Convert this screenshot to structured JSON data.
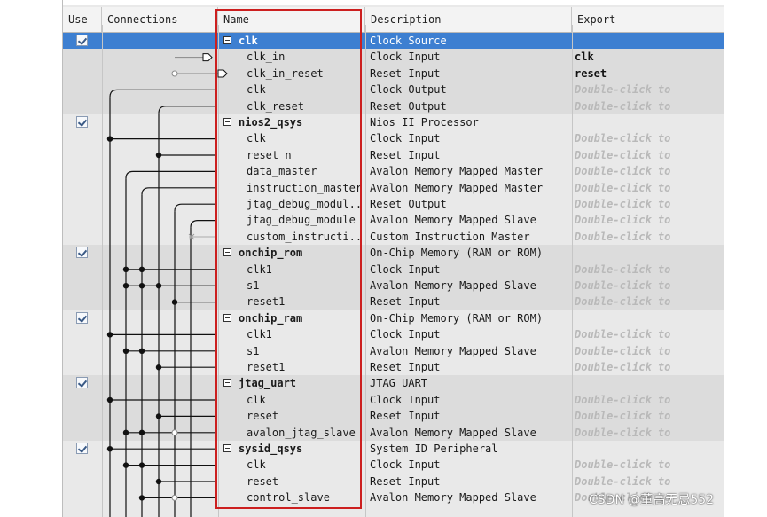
{
  "header": {
    "use": "Use",
    "connections": "Connections",
    "name": "Name",
    "description": "Description",
    "export": "Export"
  },
  "export_hint": "Double-click to",
  "rows": [
    {
      "kind": "module",
      "name": "clk",
      "desc": "Clock Source",
      "export": "",
      "checked": true,
      "selected": true
    },
    {
      "kind": "port",
      "name": "clk_in",
      "desc": "Clock Input",
      "export": "clk"
    },
    {
      "kind": "port",
      "name": "clk_in_reset",
      "desc": "Reset Input",
      "export": "reset"
    },
    {
      "kind": "port",
      "name": "clk",
      "desc": "Clock Output",
      "export": "hint"
    },
    {
      "kind": "port",
      "name": "clk_reset",
      "desc": "Reset Output",
      "export": "hint"
    },
    {
      "kind": "module",
      "name": "nios2_qsys",
      "desc": "Nios II Processor",
      "export": "",
      "checked": true
    },
    {
      "kind": "port",
      "name": "clk",
      "desc": "Clock Input",
      "export": "hint"
    },
    {
      "kind": "port",
      "name": "reset_n",
      "desc": "Reset Input",
      "export": "hint"
    },
    {
      "kind": "port",
      "name": "data_master",
      "desc": "Avalon Memory Mapped Master",
      "export": "hint"
    },
    {
      "kind": "port",
      "name": "instruction_master",
      "desc": "Avalon Memory Mapped Master",
      "export": "hint"
    },
    {
      "kind": "port",
      "name": "jtag_debug_modul...",
      "desc": "Reset Output",
      "export": "hint"
    },
    {
      "kind": "port",
      "name": "jtag_debug_module",
      "desc": "Avalon Memory Mapped Slave",
      "export": "hint"
    },
    {
      "kind": "port",
      "name": "custom_instructi...",
      "desc": "Custom Instruction Master",
      "export": "hint"
    },
    {
      "kind": "module",
      "name": "onchip_rom",
      "desc": "On-Chip Memory (RAM or ROM)",
      "export": "",
      "checked": true
    },
    {
      "kind": "port",
      "name": "clk1",
      "desc": "Clock Input",
      "export": "hint"
    },
    {
      "kind": "port",
      "name": "s1",
      "desc": "Avalon Memory Mapped Slave",
      "export": "hint"
    },
    {
      "kind": "port",
      "name": "reset1",
      "desc": "Reset Input",
      "export": "hint"
    },
    {
      "kind": "module",
      "name": "onchip_ram",
      "desc": "On-Chip Memory (RAM or ROM)",
      "export": "",
      "checked": true
    },
    {
      "kind": "port",
      "name": "clk1",
      "desc": "Clock Input",
      "export": "hint"
    },
    {
      "kind": "port",
      "name": "s1",
      "desc": "Avalon Memory Mapped Slave",
      "export": "hint"
    },
    {
      "kind": "port",
      "name": "reset1",
      "desc": "Reset Input",
      "export": "hint"
    },
    {
      "kind": "module",
      "name": "jtag_uart",
      "desc": "JTAG UART",
      "export": "",
      "checked": true
    },
    {
      "kind": "port",
      "name": "clk",
      "desc": "Clock Input",
      "export": "hint"
    },
    {
      "kind": "port",
      "name": "reset",
      "desc": "Reset Input",
      "export": "hint"
    },
    {
      "kind": "port",
      "name": "avalon_jtag_slave",
      "desc": "Avalon Memory Mapped Slave",
      "export": "hint"
    },
    {
      "kind": "module",
      "name": "sysid_qsys",
      "desc": "System ID Peripheral",
      "export": "",
      "checked": true
    },
    {
      "kind": "port",
      "name": "clk",
      "desc": "Clock Input",
      "export": "hint"
    },
    {
      "kind": "port",
      "name": "reset",
      "desc": "Reset Input",
      "export": "hint"
    },
    {
      "kind": "port",
      "name": "control_slave",
      "desc": "Avalon Memory Mapped Slave",
      "export": "hint"
    }
  ],
  "colors": {
    "selected_row": "#3d7fd1",
    "shaded_group": "#dcdcdc",
    "highlight_box": "#cc1f1f"
  },
  "watermark": "CSDN @董高无忌552"
}
